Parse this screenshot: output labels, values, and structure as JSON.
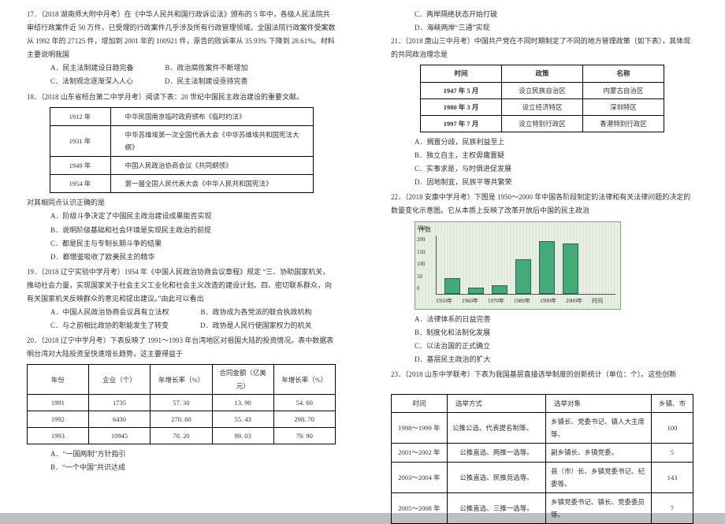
{
  "left": {
    "q17": {
      "head": "17．（2018 湖南师大附中月考）在《中华人民共和国行政诉讼法》颁布的 5 年中，各级人民法院共审结行政案件近 50 万件，已受理的行政案件几乎涉及所有行政管理领域。全国法院行政案件受案数从 1992 年的 27125 件，增加到 2001 年的 100921 件，原告的败诉率从 35.93% 下降到 28.61%。材料主要说明我国",
      "A": "A．民主法制建设日趋完备",
      "B": "B．政治腐败案件不断增加",
      "C": "C．法制观念逐渐深入人心",
      "D": "D．民主法制建设亟待完善"
    },
    "q18": {
      "head": "18．（2018 山东省桓台第二中学月考）阅读下表：20 世纪中国民主政治建设的重要文献。",
      "table": [
        [
          "1912 年",
          "中华民国南京临时政府颁布《临时约法》"
        ],
        [
          "1931 年",
          "中华苏维埃第一次全国代表大会《中华苏维埃共和国宪法大纲》"
        ],
        [
          "1949 年",
          "中国人民政治协商会议《共同纲领》"
        ],
        [
          "1954 年",
          "第一届全国人民代表大会《中华人民共和国宪法》"
        ]
      ],
      "tail": "对其相同点认识正确的是",
      "A": "A．阶级斗争决定了中国民主政治建设成果能否实现",
      "B": "B．说明阶级基础和社会环境是实现民主政治的前提",
      "C": "C．都是民主与专制长期斗争的结果",
      "D": "D．都借鉴吸收了欧美民主的精华"
    },
    "q19": {
      "head": "19．（2018 辽宁实验中学月考）1954 年《中国人民政治协商会议章程》规定 “三、协助国家机关，推动社会力量，实现国家关于社会主义工业化和社会主义改造的建设计划。四、密切联系群众，向有关国家机关反映群众的意见和提出建议。”由此可以看出",
      "A": "A．中国人民政治协商会议具有立法权",
      "B": "B．政协成为各党派的联合执政机构",
      "C": "C．与之前相比政协的职能发生了转变",
      "D": "D．政协是人民行使国家权力的机关"
    },
    "q20": {
      "head": "20．（2018 辽宁中学月考）下表反映了 1991～1993 年台湾地区对祖国大陆的投资情况。表中数据表明台湾对大陆投资呈快速增长趋势，这主要得益于",
      "headers": [
        "年份",
        "企业（个）",
        "年增长率（%）",
        "合同金额（亿美元）",
        "年增长率（%）"
      ],
      "rows": [
        [
          "1991",
          "1735",
          "57. 30",
          "13. 90",
          "54. 60"
        ],
        [
          "1992",
          "6430",
          "270. 60",
          "55. 43",
          "298. 70"
        ],
        [
          "1993",
          "10945",
          "70. 20",
          "99. 03",
          "79. 90"
        ]
      ],
      "A": "A．“一国两制”方针指引",
      "B": "B．“一个中国”共识达成"
    }
  },
  "right": {
    "q20c": "C．两岸隔绝状态开始打破",
    "q20d": "D．海峡两岸“三通”实现",
    "q21": {
      "head": "21．（2018 唐山三中月考）中国共产党在不同时期制定了不同的地方管理政策（如下表），其体现的共同政治理念是",
      "headers": [
        "时间",
        "政策",
        "名称"
      ],
      "rows": [
        [
          "1947 年 5 月",
          "设立民族自治区",
          "内蒙古自治区"
        ],
        [
          "1980 年 3 月",
          "设立经济特区",
          "深圳特区"
        ],
        [
          "1997 年 7 月",
          "设立特别行政区",
          "香港特别行政区"
        ]
      ],
      "A": "A．搁置分歧，民族利益至上",
      "B": "B．独立自主，主权毋庸置疑",
      "C": "C．实事求是，与时俱进促发展",
      "D": "D．因地制宜，民族平等共繁荣"
    },
    "q22": {
      "head": "22．（2018 安康中学月考）下图是 1950～2000 年中国各阶段制定的法律和有关法律问题的决定的数量变化示意图。它从本质上反映了改革开放后中国的民主政治",
      "A": "A．法律体系的日益完善",
      "B": "B．制度化和法制化发展",
      "C": "C．以法治国的正式确立",
      "D": "D．基层民主政治的扩大"
    },
    "q23": {
      "head": "23．（2018 山东中学联考）下表为我国基层直接选举制度的创新统计（单位：个）。这些创新",
      "headers": [
        "时间",
        "选举方式",
        "选举对象",
        "乡镇、市"
      ],
      "rows": [
        [
          "1998～1999 年",
          "公推公选、代表提名制等。",
          "乡镇长、党委书记、镇人大主席等。",
          "100"
        ],
        [
          "2001～2002 年",
          "公推直选、两推一选等。",
          "副乡镇长、乡镇党委。",
          "5"
        ],
        [
          "2003～2004 年",
          "公推直选、民推竞选等。",
          "县（市）长、乡镇党委书记、纪委等。",
          "143"
        ],
        [
          "2005～2008 年",
          "公推直选、三推一选等。",
          "乡镇党委书记、镇长、党委委员等。",
          "7"
        ]
      ]
    }
  },
  "chart_data": {
    "type": "bar",
    "title": "件数",
    "categories": [
      "1950年",
      "1960年",
      "1970年",
      "1980年",
      "1990年",
      "2000年"
    ],
    "values": [
      60,
      20,
      30,
      140,
      220,
      210
    ],
    "ylim": [
      0,
      250
    ],
    "yticks": [
      0,
      50,
      100,
      150,
      200,
      250
    ],
    "xlabel": "时间",
    "ylabel": "件数"
  }
}
